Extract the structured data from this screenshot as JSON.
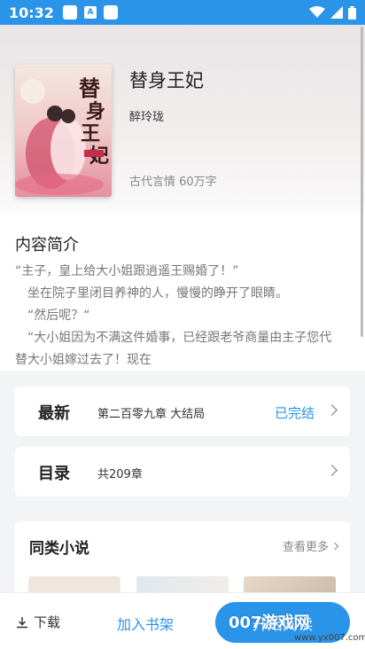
{
  "status_bar": {
    "time": "10:32",
    "notif_icons": [
      "square-icon",
      "a-icon",
      "square-icon"
    ],
    "right_icons": [
      "wifi-icon",
      "signal-icon",
      "battery-icon"
    ]
  },
  "book": {
    "title": "替身王妃",
    "author": "醉玲珑",
    "meta": "古代言情 60万字",
    "cover_text": "替身王妃"
  },
  "intro": {
    "heading": "内容简介",
    "lines": [
      "“主子，皇上给大小姐跟逍遥王赐婚了！”",
      "　坐在院子里闭目养神的人，慢慢的睁开了眼睛。",
      "　“然后呢？“",
      "　“大小姐因为不满这件婚事，已经跟老爷商量由主子您代",
      "替大小姐嫁过去了！现在"
    ]
  },
  "latest": {
    "label": "最新",
    "chapter": "第二百零九章  大结局",
    "status": "已完结"
  },
  "toc": {
    "label": "目录",
    "count": "共209章"
  },
  "similar": {
    "title": "同类小说",
    "more": "查看更多"
  },
  "bottom": {
    "download": "下载",
    "add_shelf": "加入书架",
    "read": "开始阅读"
  },
  "watermark": {
    "main": "007游戏网",
    "url": "www.yx007.com"
  },
  "colors": {
    "accent": "#2a94e8"
  }
}
